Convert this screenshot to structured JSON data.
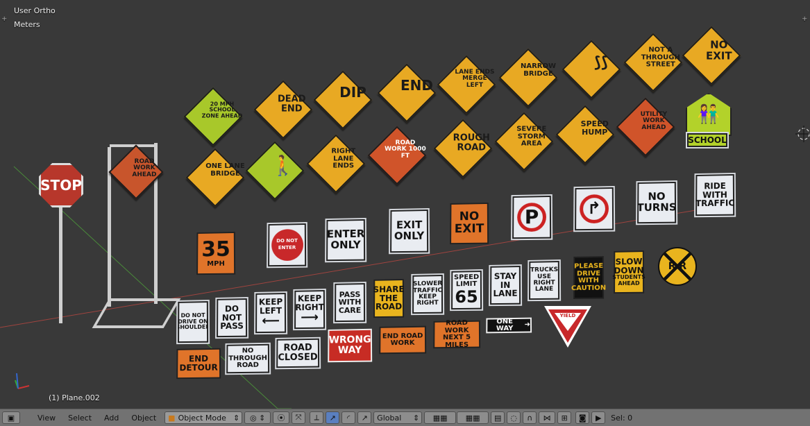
{
  "viewport": {
    "view_name": "User Ortho",
    "units": "Meters",
    "object_name": "(1) Plane.002"
  },
  "signs": {
    "stop": "STOP",
    "road_work_ahead_stand": "ROAD WORK AHEAD",
    "d_school_zone": "20 MPH SCHOOL ZONE AHEAD",
    "d_dead_end": "DEAD END",
    "d_dip": "DIP",
    "d_end": "END",
    "d_lane_ends": "LANE ENDS MERGE LEFT",
    "d_narrow_bridge": "NARROW BRIDGE",
    "d_not_through": "NOT A THROUGH STREET",
    "d_no_exit": "NO EXIT",
    "d_one_lane": "ONE LANE BRIDGE",
    "d_right_lane": "RIGHT LANE ENDS",
    "d_road_work_1000": "ROAD WORK 1000 FT",
    "d_rough_road": "ROUGH ROAD",
    "d_severe_storm": "SEVERE STORM AREA",
    "d_speed_hump": "SPEED HUMP",
    "d_utility_work": "UTILITY WORK AHEAD",
    "school": "SCHOOL",
    "r_35": "35",
    "r_mph": "MPH",
    "r_do_not_enter": "DO NOT ENTER",
    "r_enter_only": "ENTER ONLY",
    "r_exit_only": "EXIT ONLY",
    "r_no_exit": "NO EXIT",
    "r_no_turns": "NO TURNS",
    "r_ride_with": "RIDE WITH TRAFFIC",
    "r_shoulder": "DO NOT DRIVE ON SHOULDER",
    "r_do_not_pass": "DO NOT PASS",
    "r_keep_left": "KEEP LEFT",
    "r_keep_right": "KEEP RIGHT",
    "r_pass_care": "PASS WITH CARE",
    "r_share": "SHARE THE ROAD",
    "r_slower": "SLOWER TRAFFIC KEEP RIGHT",
    "r_speed_limit": "SPEED LIMIT",
    "r_65": "65",
    "r_stay_lane": "STAY IN LANE",
    "r_trucks": "TRUCKS USE RIGHT LANE",
    "r_please": "PLEASE DRIVE WITH CAUTION",
    "r_slow_down": "SLOW DOWN",
    "r_students": "STUDENTS AHEAD",
    "rr": "R R",
    "r_end_detour": "END DETOUR",
    "r_no_through_road": "NO THROUGH ROAD",
    "r_road_closed": "ROAD CLOSED",
    "r_wrong_way": "WRONG WAY",
    "r_end_road_work": "END ROAD WORK",
    "r_road_work_next": "ROAD WORK NEXT 5 MILES",
    "r_one_way": "ONE WAY",
    "r_yield": "YIELD"
  },
  "toolbar": {
    "menu_view": "View",
    "menu_select": "Select",
    "menu_add": "Add",
    "menu_object": "Object",
    "mode": "Object Mode",
    "orientation": "Global",
    "selection": "Sel: 0"
  }
}
